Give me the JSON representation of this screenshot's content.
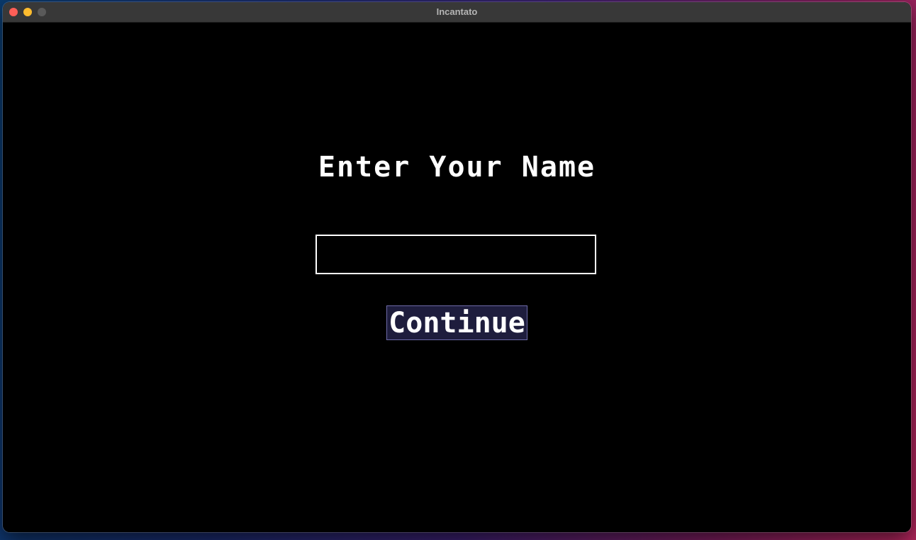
{
  "window": {
    "title": "Incantato",
    "controls": {
      "close_color": "#ff5f57",
      "minimize_color": "#febc2e",
      "zoom_color": "#5a5a5a"
    }
  },
  "screen": {
    "heading": "Enter Your Name",
    "name_input": {
      "value": "",
      "placeholder": ""
    },
    "continue_label": "Continue"
  },
  "colors": {
    "background": "#000000",
    "text": "#ffffff",
    "button_fill": "#1e1d3d",
    "button_border": "#6d6aa8"
  }
}
